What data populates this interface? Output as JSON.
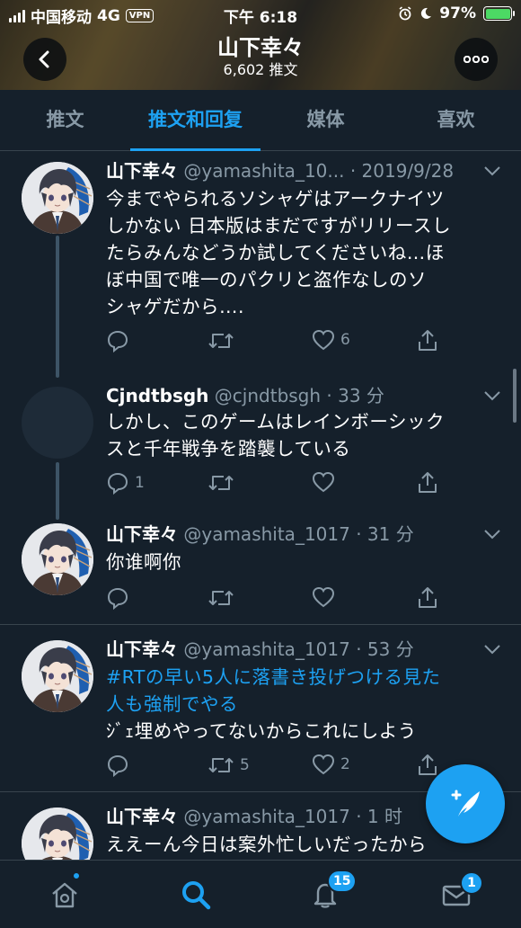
{
  "status_bar": {
    "carrier": "中国移动",
    "network": "4G",
    "vpn": "VPN",
    "time": "下午 6:18",
    "battery": "97%"
  },
  "profile": {
    "name": "山下幸々",
    "tweet_count": "6,602 推文"
  },
  "tabs": [
    {
      "label": "推文",
      "active": false
    },
    {
      "label": "推文和回复",
      "active": true
    },
    {
      "label": "媒体",
      "active": false
    },
    {
      "label": "喜欢",
      "active": false
    }
  ],
  "tweets": [
    {
      "name": "山下幸々",
      "meta": "@yamashita_10... · 2019/9/28",
      "body_lines": [
        "今までやられるソシャゲはアークナイツ",
        "しかない 日本版はまだですがリリースし",
        "たらみんなどうか試してくださいね…ほ",
        "ぼ中国で唯一のパクリと盗作なしのソ",
        "シャゲだから…."
      ],
      "replies": "",
      "retweets": "",
      "likes": "6"
    },
    {
      "name": "Cjndtbsgh",
      "meta": "@cjndtbsgh · 33 分",
      "body_lines": [
        "しかし、このゲームはレインボーシック",
        "スと千年戦争を踏襲している"
      ],
      "replies": "1",
      "retweets": "",
      "likes": ""
    },
    {
      "name": "山下幸々",
      "meta": "@yamashita_1017 · 31 分",
      "body_lines": [
        "你谁啊你"
      ],
      "replies": "",
      "retweets": "",
      "likes": ""
    },
    {
      "name": "山下幸々",
      "meta": "@yamashita_1017 · 53 分",
      "link_lines": [
        "#RTの早い5人に落書き投げつける見た",
        "人も強制でやる"
      ],
      "body_lines": [
        "ｼﾞｪ埋めやってないからこれにしよう"
      ],
      "replies": "",
      "retweets": "5",
      "likes": "2"
    },
    {
      "name": "山下幸々",
      "meta": "@yamashita_1017 · 1 时",
      "body_lines": [
        "ええーん今日は案外忙しいだったから"
      ]
    }
  ],
  "bottom_nav": {
    "notifications_badge": "15",
    "messages_badge": "1"
  },
  "colors": {
    "background": "#15202b",
    "accent": "#1da1f2",
    "muted": "#8899a6"
  },
  "icons": [
    "back-icon",
    "more-icon",
    "reply-icon",
    "retweet-icon",
    "like-icon",
    "share-icon",
    "chevron-down-icon",
    "compose-icon",
    "home-icon",
    "search-icon",
    "bell-icon",
    "mail-icon"
  ]
}
